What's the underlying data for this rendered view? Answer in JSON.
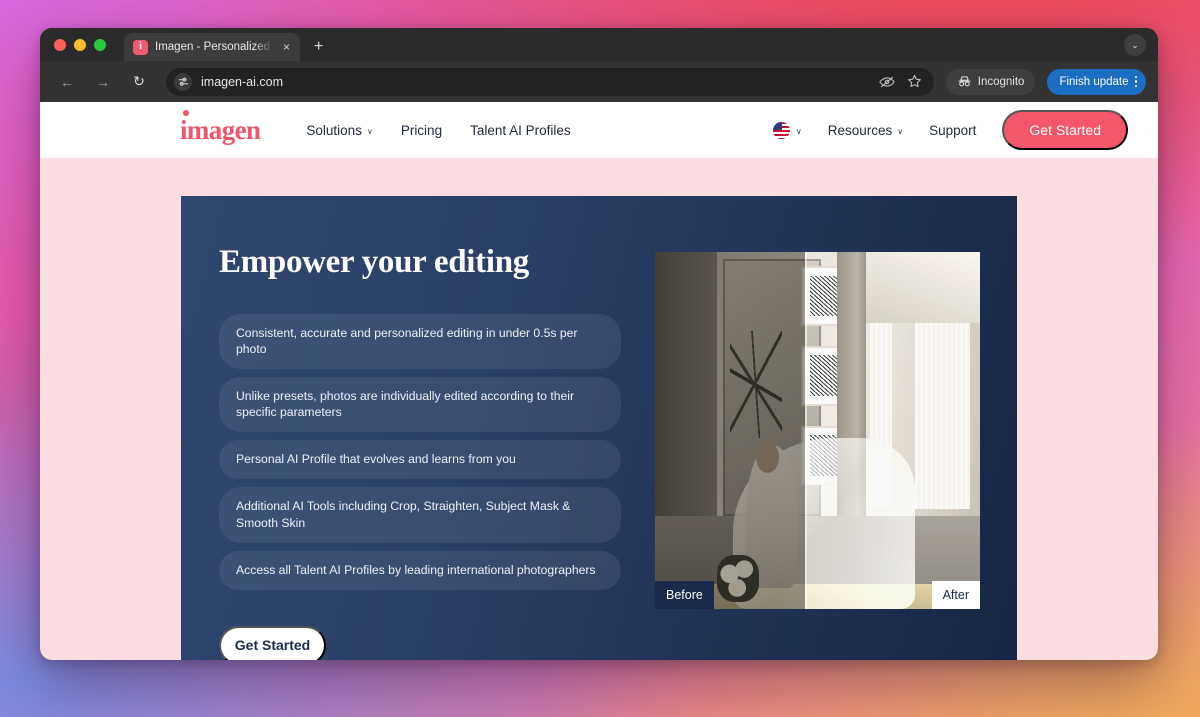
{
  "browser": {
    "tab": {
      "title": "Imagen - Personalized AI Pho",
      "favicon_letter": "i",
      "close_label": "×"
    },
    "new_tab_label": "+",
    "window_chevron": "⌄",
    "nav": {
      "back": "←",
      "forward": "→",
      "reload": "↻"
    },
    "omnibox": {
      "url": "imagen-ai.com"
    },
    "incognito_label": "Incognito",
    "update_label": "Finish update"
  },
  "site": {
    "logo": "imagen",
    "nav_left": [
      {
        "label": "Solutions",
        "has_caret": true
      },
      {
        "label": "Pricing",
        "has_caret": false
      },
      {
        "label": "Talent AI Profiles",
        "has_caret": false
      }
    ],
    "nav_right": [
      {
        "label": "Resources",
        "has_caret": true
      },
      {
        "label": "Support",
        "has_caret": false
      }
    ],
    "cta_label": "Get Started",
    "caret_glyph": "∨"
  },
  "hero": {
    "title": "Empower your editing",
    "features": [
      "Consistent, accurate and personalized editing in under 0.5s per photo",
      "Unlike presets, photos are individually edited according to their specific parameters",
      "Personal AI Profile that evolves and learns from you",
      "Additional AI Tools including Crop, Straighten, Subject Mask & Smooth Skin",
      "Access all Talent AI Profiles by leading international photographers"
    ],
    "cta_label": "Get Started",
    "image": {
      "before_label": "Before",
      "after_label": "After"
    }
  },
  "colors": {
    "brand_coral": "#f4566b",
    "hero_navy": "#2e4470",
    "page_pink": "#fadde1",
    "update_blue": "#1b6ec2"
  }
}
